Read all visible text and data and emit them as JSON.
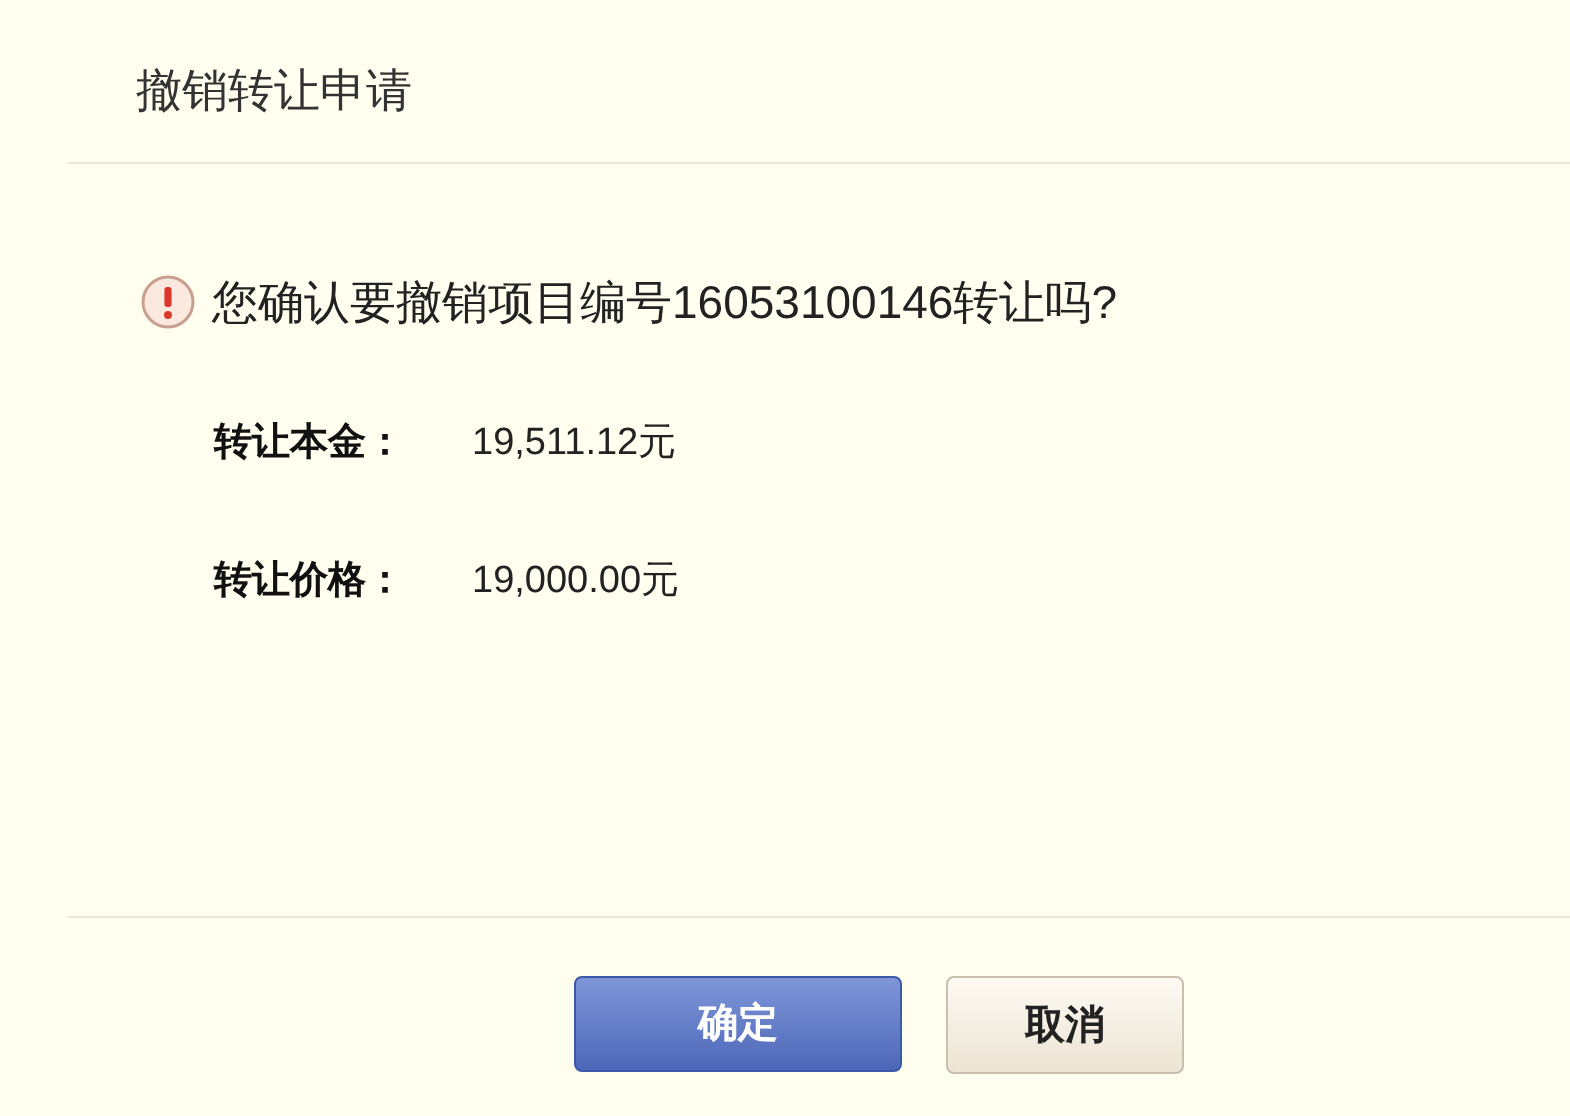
{
  "dialog": {
    "title": "撤销转让申请",
    "message": "您确认要撤销项目编号16053100146转让吗?",
    "fields": [
      {
        "label": "转让本金：",
        "value": "19,511.12元"
      },
      {
        "label": "转让价格：",
        "value": "19,000.00元"
      }
    ],
    "buttons": [
      {
        "label": "确定",
        "kind": "primary"
      },
      {
        "label": "取消",
        "kind": "secondary"
      }
    ]
  }
}
